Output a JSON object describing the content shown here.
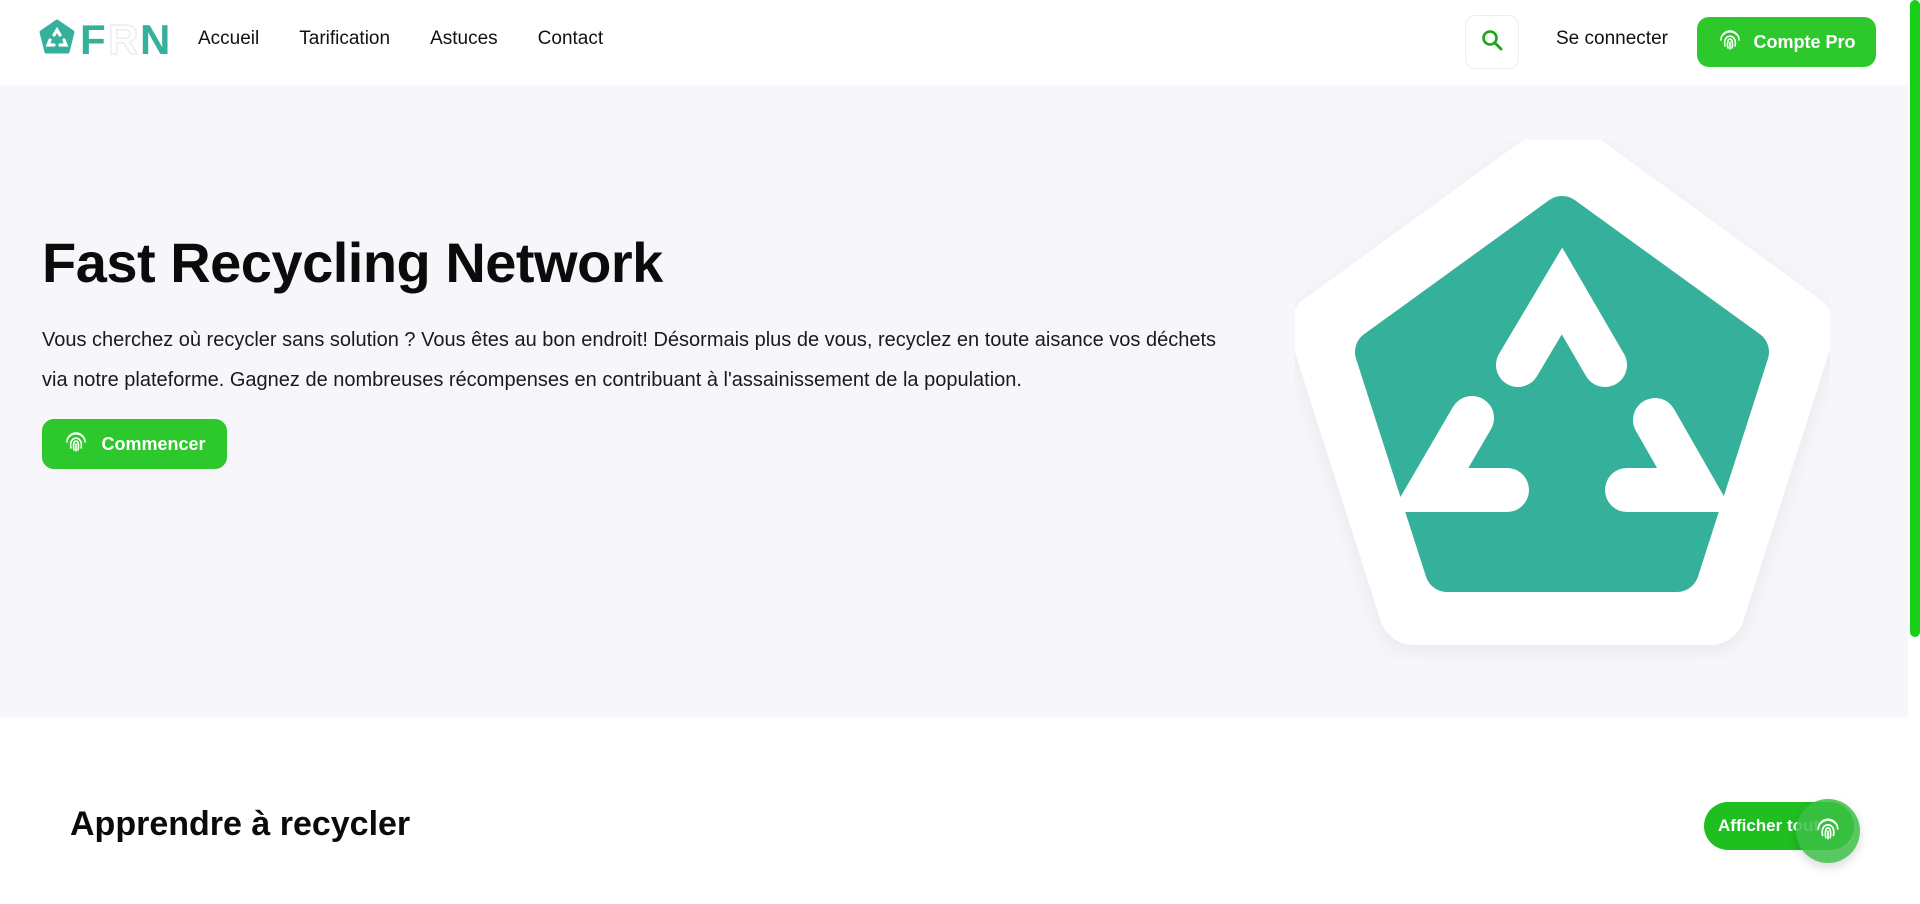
{
  "colors": {
    "accent": "#2cc82c",
    "brand_teal": "#35b09a",
    "hero_bg": "#f7f7fb",
    "scroll_thumb": "#18cf18"
  },
  "header": {
    "logo_text": "FRN",
    "nav": [
      "Accueil",
      "Tarification",
      "Astuces",
      "Contact"
    ],
    "search_icon": "search-icon",
    "signin_label": "Se connecter",
    "pro_label": "Compte Pro",
    "pro_icon": "fingerprint-icon"
  },
  "hero": {
    "title": "Fast Recycling Network",
    "text": "Vous cherchez où recycler sans solution ? Vous êtes au bon endroit! Désormais plus de vous, recyclez en toute aisance vos déchets via notre plateforme. Gagnez de nombreuses récompenses en contribuant à l'assainissement de la population.",
    "cta_label": "Commencer",
    "cta_icon": "fingerprint-icon",
    "art_icon": "recycle-pentagon-icon"
  },
  "section": {
    "title": "Apprendre à recycler",
    "show_all_label": "Afficher tout"
  },
  "fab": {
    "icon": "fingerprint-icon"
  }
}
